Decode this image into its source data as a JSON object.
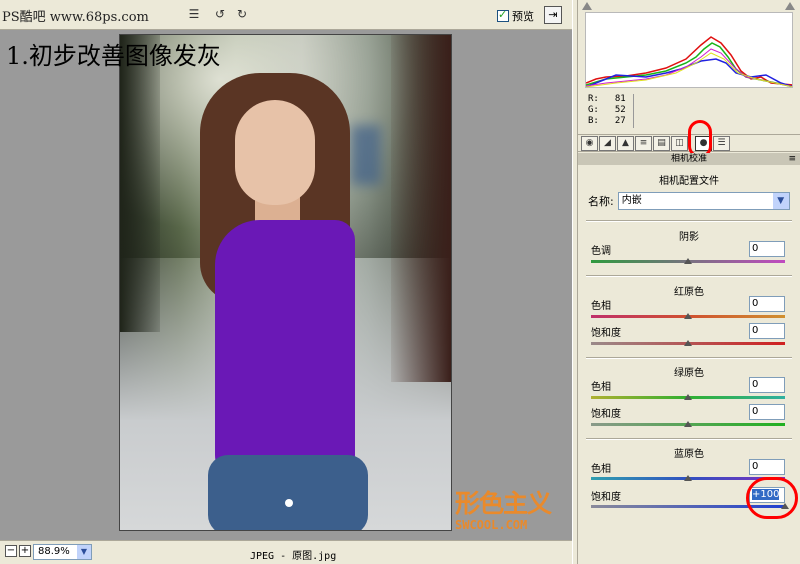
{
  "toolbar": {
    "watermark": "PS酷吧 www.68ps.com",
    "tools": [
      "zoom-icon",
      "hand-icon",
      "white-balance-icon",
      "color-sampler-icon",
      "crop-icon",
      "straighten-icon",
      "red-eye-icon",
      "list-icon",
      "rotate-left-icon",
      "rotate-right-icon"
    ],
    "preview_label": "预览",
    "preview_checked": true
  },
  "canvas": {
    "step_title": "1.初步改善图像发灰",
    "logo_text": "形色主义",
    "logo_url": "SWCOOL.COM"
  },
  "status": {
    "zoom": "88.9%",
    "file_info": "JPEG -  原图.jpg"
  },
  "histogram": {
    "readout": [
      {
        "label": "R:",
        "value": "81"
      },
      {
        "label": "G:",
        "value": "52"
      },
      {
        "label": "B:",
        "value": "27"
      }
    ]
  },
  "tabs": {
    "icons": [
      "basic-icon",
      "tone-curve-icon",
      "detail-icon",
      "hsl-icon",
      "split-toning-icon",
      "lens-corrections-icon",
      "camera-calibration-icon",
      "presets-icon"
    ],
    "active_index": 6
  },
  "panel": {
    "section_title": "相机校准",
    "profile_title": "相机配置文件",
    "name_label": "名称:",
    "name_value": "内嵌",
    "groups": [
      {
        "title": "阴影",
        "sliders": [
          {
            "label": "色调",
            "value": "0",
            "level": 0.5
          }
        ]
      },
      {
        "title": "红原色",
        "sliders": [
          {
            "label": "色相",
            "value": "0",
            "level": 0.5
          },
          {
            "label": "饱和度",
            "value": "0",
            "level": 0.5
          }
        ]
      },
      {
        "title": "绿原色",
        "sliders": [
          {
            "label": "色相",
            "value": "0",
            "level": 0.5
          },
          {
            "label": "饱和度",
            "value": "0",
            "level": 0.5
          }
        ]
      },
      {
        "title": "蓝原色",
        "sliders": [
          {
            "label": "色相",
            "value": "0",
            "level": 0.5
          },
          {
            "label": "饱和度",
            "value": "+100",
            "level": 1.0
          }
        ]
      }
    ]
  },
  "colors": {
    "highlight": "#ff0000",
    "selection": "#316ac5",
    "logo": "#e98a2c"
  }
}
